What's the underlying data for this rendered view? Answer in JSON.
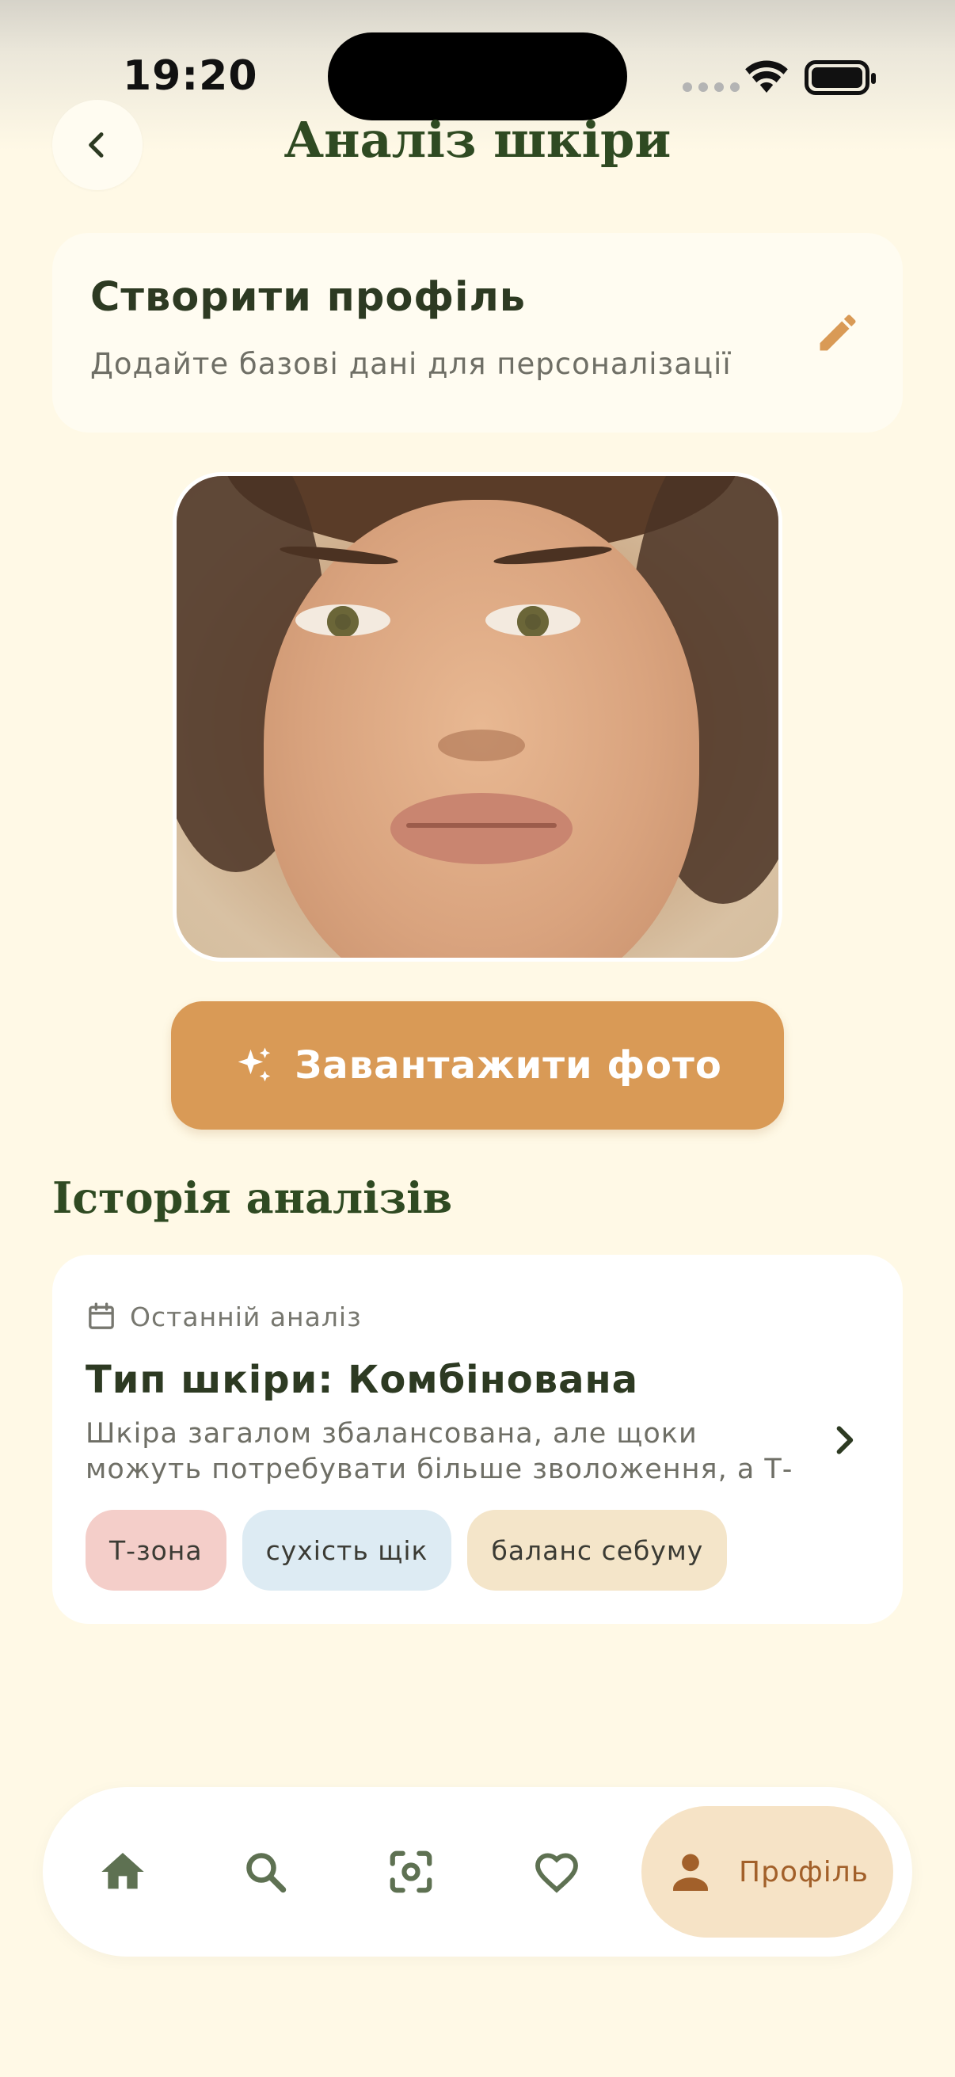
{
  "status_bar": {
    "time": "19:20"
  },
  "header": {
    "title": "Аналіз шкіри"
  },
  "profile_card": {
    "title": "Створити профіль",
    "subtitle": "Додайте базові дані для персоналізації"
  },
  "upload": {
    "label": "Завантажити фото"
  },
  "history": {
    "title": "Історія аналізів",
    "last_label": "Останній аналіз",
    "skin_type": "Тип шкіри: Комбінована",
    "description": "Шкіра загалом збалансована, але щоки можуть потребувати більше зволоження, а Т-зона -",
    "tags": [
      "Т-зона",
      "сухість щік",
      "баланс себуму"
    ]
  },
  "bottom_nav": {
    "items": [
      "home-icon",
      "search-icon",
      "scan-icon",
      "heart-icon",
      "person-icon"
    ],
    "active_label": "Профіль"
  },
  "colors": {
    "background": "#FFF9E6",
    "accent": "#D99A56",
    "title_green": "#2F4A22",
    "tag_pink": "#F4CEC9",
    "tag_blue": "#DDEBF3",
    "tag_beige": "#F4E5C9",
    "nav_active": "#F6E3C6"
  }
}
